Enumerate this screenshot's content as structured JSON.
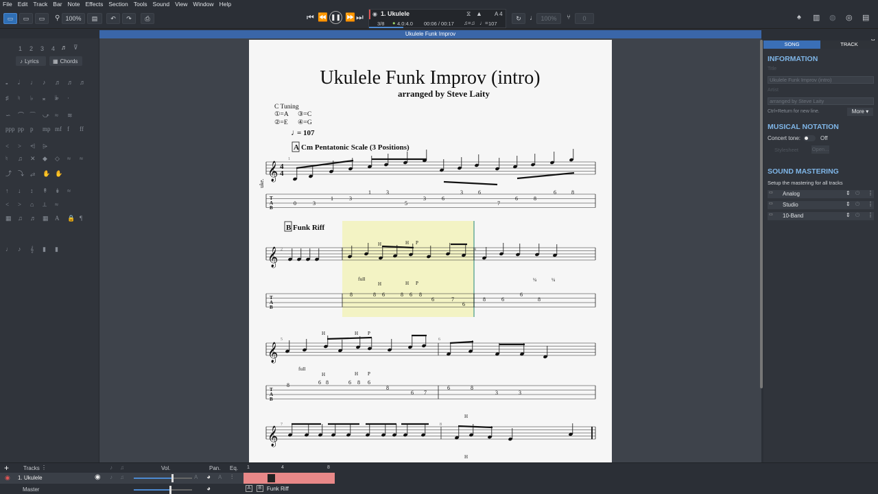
{
  "menu": [
    "File",
    "Edit",
    "Track",
    "Bar",
    "Note",
    "Effects",
    "Section",
    "Tools",
    "Sound",
    "View",
    "Window",
    "Help"
  ],
  "toolbar": {
    "zoom": "100%",
    "track_name": "1. Ukulele",
    "bar_position": "3/8",
    "signature": "4.0:4.0",
    "time": "00:06 / 00:17",
    "tempo": "107",
    "key": "A",
    "key_num": "4",
    "speed": "100%",
    "pitch": "0"
  },
  "document_title": "Ukulele Funk Improv",
  "left_panel": {
    "voices": [
      "1",
      "2",
      "3",
      "4"
    ],
    "lyrics_label": "Lyrics",
    "chords_label": "Chords"
  },
  "score": {
    "title": "Ukulele Funk Improv (intro)",
    "subtitle": "arranged by Steve Laity",
    "tuning_header": "C Tuning",
    "tuning": [
      "①=A",
      "③=C",
      "②=E",
      "④=G"
    ],
    "tempo": "= 107",
    "instrument_abbr": "uke.",
    "section_a_letter": "A",
    "section_a_name": "Cm Pentatonic Scale (3 Positions)",
    "section_b_letter": "B",
    "section_b_name": "Funk Riff",
    "time_sig_top": "4",
    "time_sig_bottom": "4",
    "tab_label": [
      "T",
      "A",
      "B"
    ],
    "bar_numbers": [
      "1",
      "2",
      "3",
      "4",
      "5",
      "6",
      "7",
      "8"
    ],
    "sys1_tab": [
      "0",
      "3",
      "1",
      "3",
      "1",
      "3",
      "5",
      "3",
      "6",
      "3",
      "6",
      "7",
      "6",
      "8",
      "6",
      "8"
    ],
    "sys2_tab": [
      "8",
      "8",
      "6",
      "8",
      "6",
      "8",
      "6",
      "7",
      "6",
      "8",
      "6",
      "6",
      "8"
    ],
    "sys3_tab": [
      "8",
      "6",
      "8",
      "6",
      "8",
      "6",
      "8",
      "6",
      "7",
      "6",
      "8",
      "3",
      "3",
      "0"
    ],
    "annotations": {
      "full": "full",
      "hammer": "H",
      "pull": "P",
      "quarter": "¼"
    }
  },
  "right_panel": {
    "tabs": [
      "SONG",
      "TRACK"
    ],
    "information_header": "INFORMATION",
    "title_label": "Title",
    "title_value": "Ukulele Funk Improv (intro)",
    "artist_label": "Artist",
    "artist_value": "arranged by Steve Laity",
    "hint": "Ctrl+Return for new line.",
    "more_button": "More ▾",
    "notation_header": "MUSICAL NOTATION",
    "concert_tone_label": "Concert tone:",
    "concert_tone_state": "Off",
    "stylesheet_label": "Stylesheet",
    "stylesheet_button": "Open...",
    "mastering_header": "SOUND MASTERING",
    "mastering_desc": "Setup the mastering for all tracks",
    "effects": [
      "Analog",
      "Studio",
      "10-Band"
    ]
  },
  "bottom": {
    "tracks_label": "Tracks",
    "vol_label": "Vol.",
    "pan_label": "Pan.",
    "eq_label": "Eq.",
    "track_name": "1. Ukulele",
    "master_label": "Master",
    "bar_markers": [
      "1",
      "4",
      "8"
    ],
    "sections": [
      "A",
      "B"
    ],
    "section_label": "Funk Riff"
  }
}
